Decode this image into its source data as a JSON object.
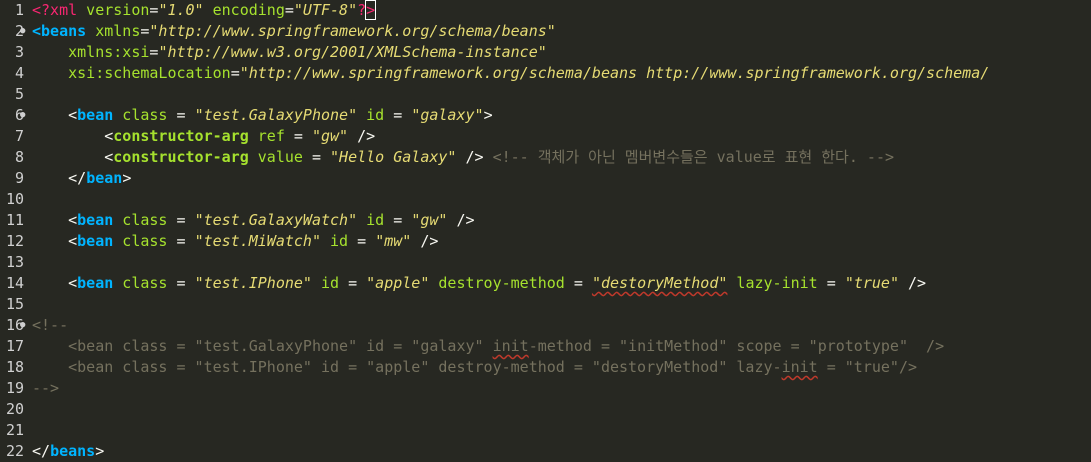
{
  "editor": {
    "lines": [
      {
        "n": "1",
        "fold": "",
        "segs": [
          {
            "t": "<?xml",
            "c": "pi"
          },
          {
            "t": " version",
            "c": "attr"
          },
          {
            "t": "=",
            "c": "eq"
          },
          {
            "t": "\"1.0\"",
            "c": "str"
          },
          {
            "t": " encoding",
            "c": "attr"
          },
          {
            "t": "=",
            "c": "eq"
          },
          {
            "t": "\"UTF-8\"",
            "c": "str"
          },
          {
            "t": "?",
            "c": "pi"
          },
          {
            "t": ">",
            "c": "pi cursorbox"
          }
        ]
      },
      {
        "n": "2",
        "fold": "●",
        "segs": [
          {
            "t": "<",
            "c": "tag"
          },
          {
            "t": "beans",
            "c": "tag"
          },
          {
            "t": " xmlns",
            "c": "attr"
          },
          {
            "t": "=",
            "c": "eq"
          },
          {
            "t": "\"http://www.springframework.org/schema/beans\"",
            "c": "str"
          }
        ]
      },
      {
        "n": "3",
        "fold": "",
        "segs": [
          {
            "t": "    xmlns:xsi",
            "c": "attr"
          },
          {
            "t": "=",
            "c": "eq"
          },
          {
            "t": "\"http://www.w3.org/2001/XMLSchema-instance\"",
            "c": "str"
          }
        ]
      },
      {
        "n": "4",
        "fold": "",
        "segs": [
          {
            "t": "    xsi:schemaLocation",
            "c": "attr"
          },
          {
            "t": "=",
            "c": "eq"
          },
          {
            "t": "\"http://www.springframework.org/schema/beans http://www.springframework.org/schema/",
            "c": "str"
          }
        ]
      },
      {
        "n": "5",
        "fold": "",
        "segs": []
      },
      {
        "n": "6",
        "fold": "●",
        "segs": [
          {
            "t": "    <",
            "c": "punc"
          },
          {
            "t": "bean",
            "c": "tag"
          },
          {
            "t": " class",
            "c": "attr"
          },
          {
            "t": " = ",
            "c": "eq"
          },
          {
            "t": "\"test.GalaxyPhone\"",
            "c": "str"
          },
          {
            "t": " id",
            "c": "attr"
          },
          {
            "t": " = ",
            "c": "eq"
          },
          {
            "t": "\"galaxy\"",
            "c": "str"
          },
          {
            "t": ">",
            "c": "punc"
          }
        ]
      },
      {
        "n": "7",
        "fold": "",
        "segs": [
          {
            "t": "        <",
            "c": "punc"
          },
          {
            "t": "constructor-arg",
            "c": "elem"
          },
          {
            "t": " ref",
            "c": "attr"
          },
          {
            "t": " = ",
            "c": "eq"
          },
          {
            "t": "\"gw\"",
            "c": "str"
          },
          {
            "t": " />",
            "c": "punc"
          }
        ]
      },
      {
        "n": "8",
        "fold": "",
        "segs": [
          {
            "t": "        <",
            "c": "punc"
          },
          {
            "t": "constructor-arg",
            "c": "elem"
          },
          {
            "t": " value",
            "c": "attr"
          },
          {
            "t": " = ",
            "c": "eq"
          },
          {
            "t": "\"Hello Galaxy\"",
            "c": "str"
          },
          {
            "t": " />",
            "c": "punc"
          },
          {
            "t": " <!-- 객체가 아닌 멤버변수들은 value로 표현 한다. -->",
            "c": "comment"
          }
        ]
      },
      {
        "n": "9",
        "fold": "",
        "segs": [
          {
            "t": "    </",
            "c": "punc"
          },
          {
            "t": "bean",
            "c": "tag"
          },
          {
            "t": ">",
            "c": "punc"
          }
        ]
      },
      {
        "n": "10",
        "fold": "",
        "segs": []
      },
      {
        "n": "11",
        "fold": "",
        "segs": [
          {
            "t": "    <",
            "c": "punc"
          },
          {
            "t": "bean",
            "c": "tag"
          },
          {
            "t": " class",
            "c": "attr"
          },
          {
            "t": " = ",
            "c": "eq"
          },
          {
            "t": "\"test.GalaxyWatch\"",
            "c": "str"
          },
          {
            "t": " id",
            "c": "attr"
          },
          {
            "t": " = ",
            "c": "eq"
          },
          {
            "t": "\"gw\"",
            "c": "str"
          },
          {
            "t": " />",
            "c": "punc"
          }
        ]
      },
      {
        "n": "12",
        "fold": "",
        "segs": [
          {
            "t": "    <",
            "c": "punc"
          },
          {
            "t": "bean",
            "c": "tag"
          },
          {
            "t": " class",
            "c": "attr"
          },
          {
            "t": " = ",
            "c": "eq"
          },
          {
            "t": "\"test.MiWatch\"",
            "c": "str"
          },
          {
            "t": " id",
            "c": "attr"
          },
          {
            "t": " = ",
            "c": "eq"
          },
          {
            "t": "\"mw\"",
            "c": "str"
          },
          {
            "t": " />",
            "c": "punc"
          }
        ]
      },
      {
        "n": "13",
        "fold": "",
        "segs": []
      },
      {
        "n": "14",
        "fold": "",
        "segs": [
          {
            "t": "    <",
            "c": "punc"
          },
          {
            "t": "bean",
            "c": "tag"
          },
          {
            "t": " class",
            "c": "attr"
          },
          {
            "t": " = ",
            "c": "eq"
          },
          {
            "t": "\"test.IPhone\"",
            "c": "str"
          },
          {
            "t": " id",
            "c": "attr"
          },
          {
            "t": " = ",
            "c": "eq"
          },
          {
            "t": "\"apple\"",
            "c": "str"
          },
          {
            "t": " destroy-method",
            "c": "attr"
          },
          {
            "t": " = ",
            "c": "eq"
          },
          {
            "t": "\"destoryMethod\"",
            "c": "str squig"
          },
          {
            "t": " lazy-init",
            "c": "attr"
          },
          {
            "t": " = ",
            "c": "eq"
          },
          {
            "t": "\"true\"",
            "c": "str"
          },
          {
            "t": " />",
            "c": "punc"
          }
        ]
      },
      {
        "n": "15",
        "fold": "",
        "segs": []
      },
      {
        "n": "16",
        "fold": "●",
        "segs": [
          {
            "t": "<!--",
            "c": "comment"
          }
        ]
      },
      {
        "n": "17",
        "fold": "",
        "segs": [
          {
            "t": "    <bean class = \"test.GalaxyPhone\" id = \"galaxy\" ",
            "c": "comment"
          },
          {
            "t": "init",
            "c": "comment squig"
          },
          {
            "t": "-method = \"initMethod\" scope = \"prototype\"  />",
            "c": "comment"
          }
        ]
      },
      {
        "n": "18",
        "fold": "",
        "segs": [
          {
            "t": "    <bean class = \"test.IPhone\" id = \"apple\" destroy-method = \"destoryMethod\" lazy-",
            "c": "comment"
          },
          {
            "t": "init",
            "c": "comment squig"
          },
          {
            "t": " = \"true\"/>",
            "c": "comment"
          }
        ]
      },
      {
        "n": "19",
        "fold": "",
        "segs": [
          {
            "t": "-->",
            "c": "comment"
          }
        ]
      },
      {
        "n": "20",
        "fold": "",
        "segs": []
      },
      {
        "n": "21",
        "fold": "",
        "segs": []
      },
      {
        "n": "22",
        "fold": "",
        "segs": [
          {
            "t": "</",
            "c": "punc"
          },
          {
            "t": "beans",
            "c": "tag"
          },
          {
            "t": ">",
            "c": "punc"
          }
        ]
      }
    ]
  },
  "colors": {
    "background": "#272822",
    "tag": "#00b4ff",
    "attribute": "#a6e22e",
    "string": "#e6db74",
    "comment": "#75715e"
  }
}
